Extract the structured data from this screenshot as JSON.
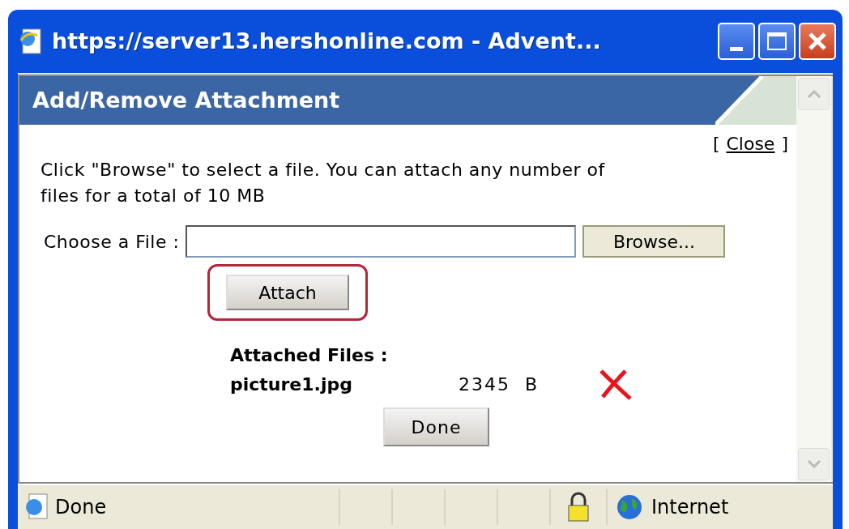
{
  "window": {
    "title": "https://server13.hershonline.com - Advent..."
  },
  "dialog": {
    "title": "Add/Remove Attachment",
    "close_link": "Close",
    "close_brackets": [
      "[",
      "]"
    ],
    "instructions": "Click \"Browse\" to select a file. You can attach any number of files for a total of 10 MB",
    "file_field": {
      "label": "Choose a File :"
    },
    "browse_button": "Browse...",
    "attach_button": {
      "label": "Attach",
      "highlighted": true
    },
    "attached_files": {
      "heading": "Attached Files :",
      "files": [
        {
          "name": "picture1.jpg",
          "size": "2345  B"
        }
      ]
    },
    "done_button": "Done"
  },
  "status_bar": {
    "text": "Done",
    "zone": "Internet",
    "secure": true
  }
}
